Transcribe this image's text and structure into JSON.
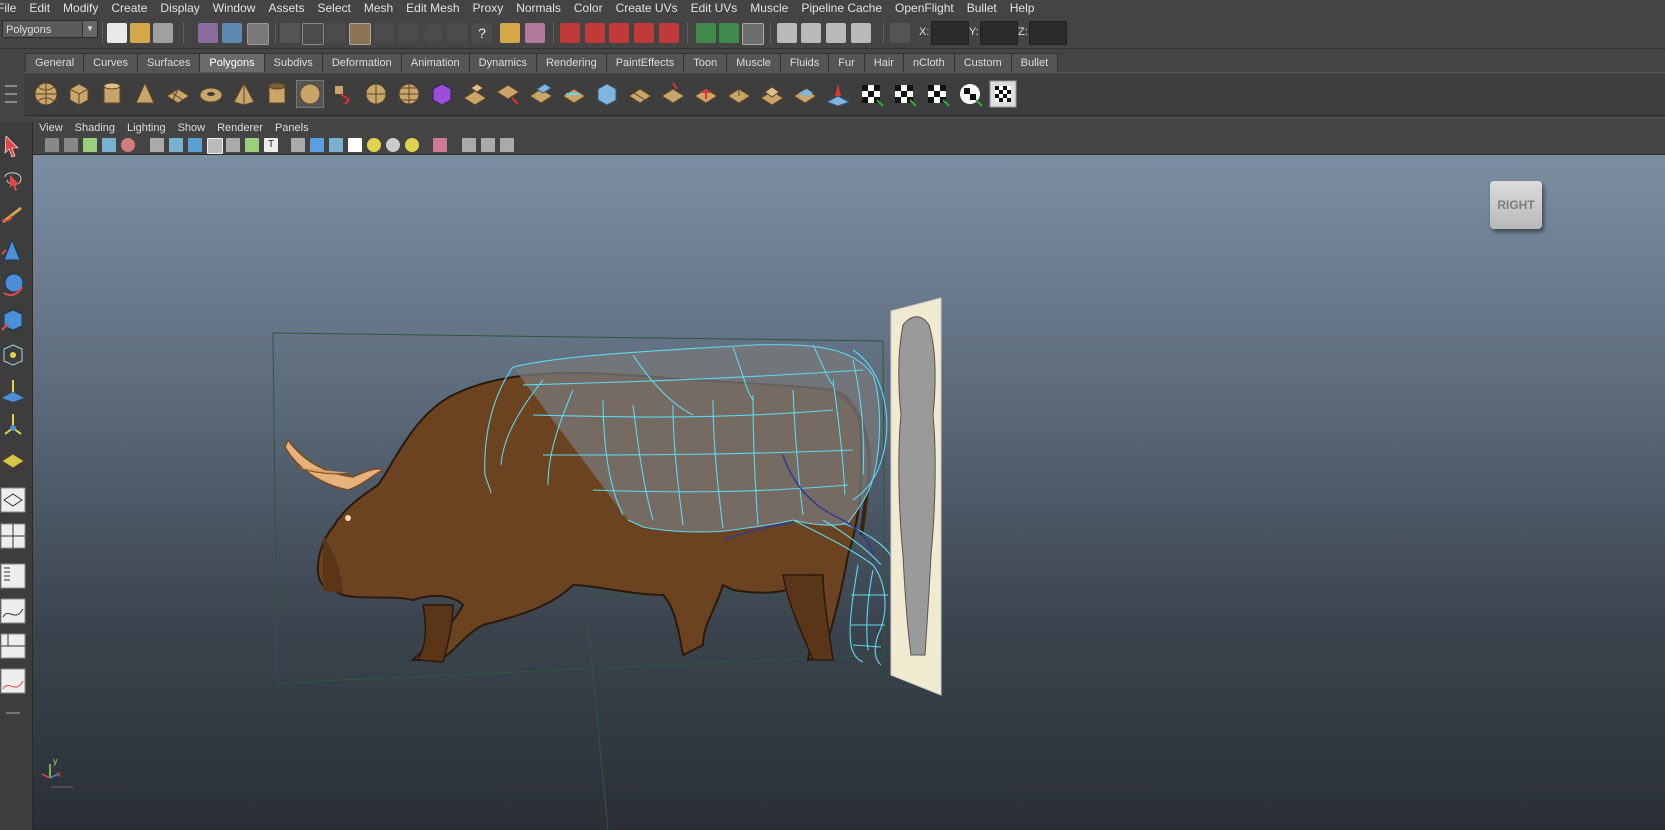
{
  "menubar": {
    "items": [
      "File",
      "Edit",
      "Modify",
      "Create",
      "Display",
      "Window",
      "Assets",
      "Select",
      "Mesh",
      "Edit Mesh",
      "Proxy",
      "Normals",
      "Color",
      "Create UVs",
      "Edit UVs",
      "Muscle",
      "Pipeline Cache",
      "OpenFlight",
      "Bullet",
      "Help"
    ]
  },
  "statusline": {
    "mode": "Polygons",
    "coord_x_label": "X:",
    "coord_y_label": "Y:",
    "coord_z_label": "Z:"
  },
  "shelf": {
    "tabs": [
      "General",
      "Curves",
      "Surfaces",
      "Polygons",
      "Subdivs",
      "Deformation",
      "Animation",
      "Dynamics",
      "Rendering",
      "PaintEffects",
      "Toon",
      "Muscle",
      "Fluids",
      "Fur",
      "Hair",
      "nCloth",
      "Custom",
      "Bullet"
    ],
    "active_tab": "Polygons"
  },
  "panel": {
    "menu": [
      "View",
      "Shading",
      "Lighting",
      "Show",
      "Renderer",
      "Panels"
    ]
  },
  "viewport": {
    "view_cube_label": "RIGHT",
    "axis_y": "y",
    "axis_x": "x",
    "wire_color": "#5fd8ef",
    "bull_color": "#6b4320",
    "horn_color": "#e8b07a"
  }
}
